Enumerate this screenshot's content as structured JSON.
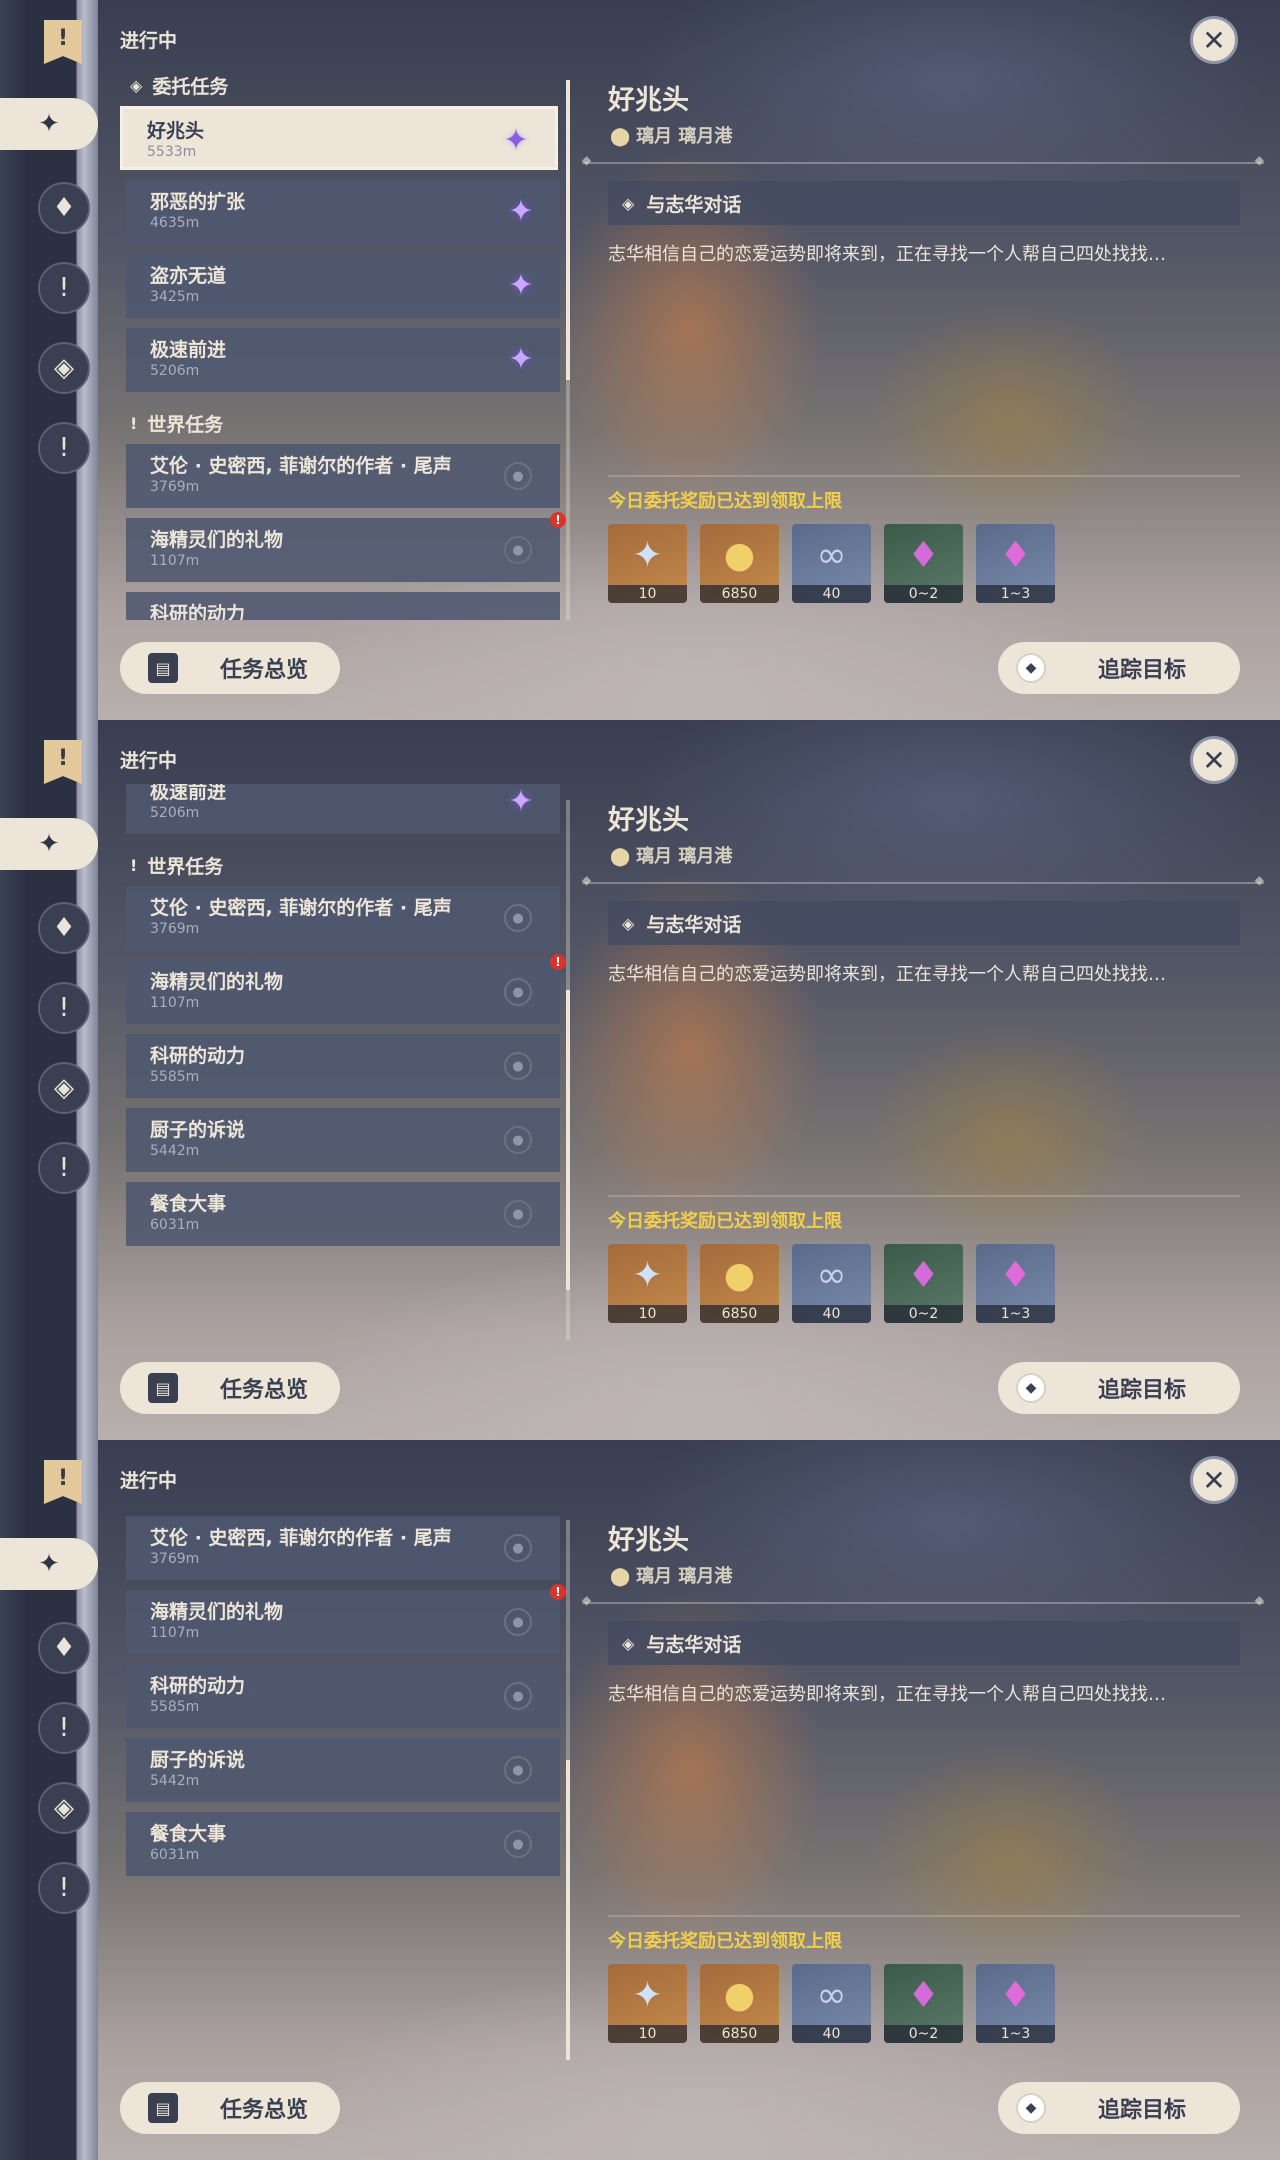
{
  "common": {
    "in_progress": "进行中",
    "close_symbol": "✕",
    "overview_button": "任务总览",
    "track_button": "追踪目标",
    "detail": {
      "title": "好兆头",
      "location": "璃月 璃月港",
      "objective": "与志华对话",
      "description": "志华相信自己的恋爱运势即将来到，正在寻找一个人帮自己四处找找…",
      "reward_note": "今日委托奖励已达到领取上限"
    },
    "rewards": [
      {
        "icon": "primogem-icon",
        "count": "10"
      },
      {
        "icon": "mora-icon",
        "count": "6850"
      },
      {
        "icon": "exp-icon",
        "count": "40"
      },
      {
        "icon": "crystal-icon",
        "count": "0~2"
      },
      {
        "icon": "crystal-cluster-icon",
        "count": "1~3"
      }
    ],
    "colors": {
      "accent": "#ECE5D8",
      "reward_note": "#F2CF4A",
      "alert": "#D9332B"
    }
  },
  "sections": {
    "commission": "委托任务",
    "world": "世界任务"
  },
  "quests": {
    "q1": {
      "name": "好兆头",
      "dist": "5533m"
    },
    "q2": {
      "name": "邪恶的扩张",
      "dist": "4635m"
    },
    "q3": {
      "name": "盗亦无道",
      "dist": "3425m"
    },
    "q4": {
      "name": "极速前进",
      "dist": "5206m"
    },
    "w1": {
      "name": "艾伦 · 史密西, 菲谢尔的作者 · 尾声",
      "dist": "3769m"
    },
    "w2": {
      "name": "海精灵们的礼物",
      "dist": "1107m"
    },
    "w3": {
      "name": "科研的动力",
      "dist": "5585m"
    },
    "w4": {
      "name": "厨子的诉说",
      "dist": "5442m"
    },
    "w5": {
      "name": "餐食大事",
      "dist": "6031m"
    }
  },
  "screens": [
    {
      "scroll_position": 0.0
    },
    {
      "scroll_position": 0.62
    },
    {
      "scroll_position": 1.0
    }
  ]
}
